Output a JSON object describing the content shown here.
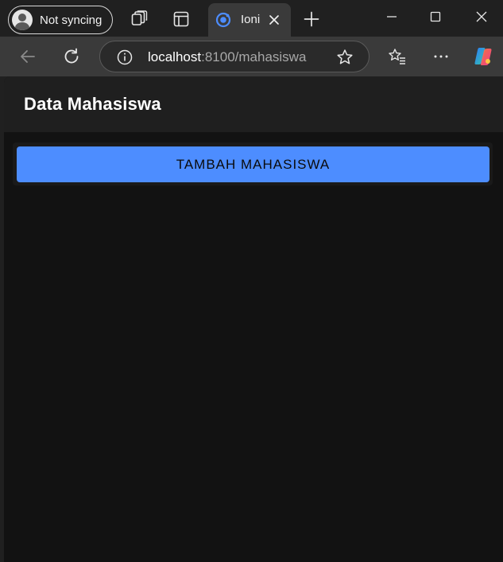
{
  "browser": {
    "profile_label": "Not syncing",
    "tab_title": "Ioni",
    "url_host": "localhost",
    "url_path": ":8100/mahasiswa",
    "icons": [
      "profile-avatar-icon",
      "workspaces-icon",
      "tab-actions-icon",
      "ionic-favicon-icon",
      "close-tab-icon",
      "new-tab-icon",
      "minimize-icon",
      "maximize-icon",
      "close-window-icon",
      "back-icon",
      "refresh-icon",
      "site-info-icon",
      "favorite-star-icon",
      "favorites-icon",
      "more-icon",
      "copilot-icon"
    ],
    "colors": {
      "tabstrip": "#202020",
      "toolbar": "#3a3a3a",
      "accent": "#4d8dff"
    }
  },
  "app": {
    "title": "Data Mahasiswa",
    "primary_button_label": "TAMBAH MAHASISWA",
    "colors": {
      "header": "#1f1f1f",
      "content": "#121212",
      "button": "#4d8dff"
    }
  }
}
